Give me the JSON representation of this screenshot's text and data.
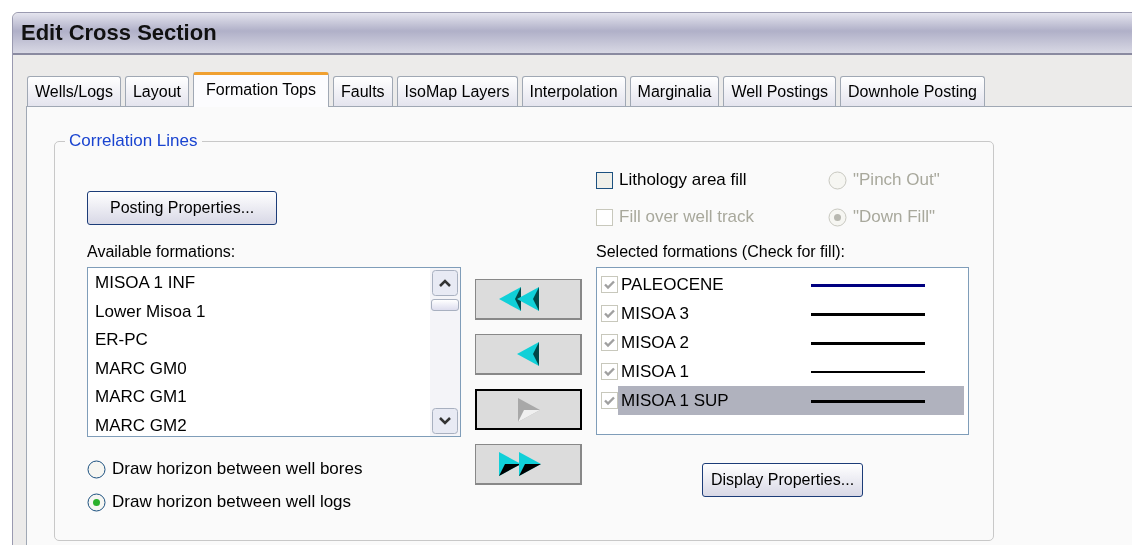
{
  "window": {
    "title": "Edit Cross Section"
  },
  "tabs": [
    {
      "label": "Wells/Logs",
      "selected": false
    },
    {
      "label": "Layout",
      "selected": false
    },
    {
      "label": "Formation Tops",
      "selected": true
    },
    {
      "label": "Faults",
      "selected": false
    },
    {
      "label": "IsoMap Layers",
      "selected": false
    },
    {
      "label": "Interpolation",
      "selected": false
    },
    {
      "label": "Marginalia",
      "selected": false
    },
    {
      "label": "Well Postings",
      "selected": false
    },
    {
      "label": "Downhole Posting",
      "selected": false
    }
  ],
  "group": {
    "title": "Correlation Lines"
  },
  "posting_button": "Posting Properties...",
  "available": {
    "label": "Available formations:",
    "items": [
      {
        "label": "MISOA 1 INF",
        "selected": false
      },
      {
        "label": "Lower Misoa 1",
        "selected": false
      },
      {
        "label": "ER-PC",
        "selected": false
      },
      {
        "label": "MARC GM0",
        "selected": false
      },
      {
        "label": "MARC GM1",
        "selected": false
      },
      {
        "label": "MARC GM2",
        "selected": false
      }
    ]
  },
  "horizon_options": [
    {
      "label": "Draw horizon between well bores",
      "selected": false
    },
    {
      "label": "Draw horizon between well logs",
      "selected": true
    }
  ],
  "move_buttons": [
    {
      "kind": "all-left",
      "disabled": false,
      "focused": false
    },
    {
      "kind": "left",
      "disabled": false,
      "focused": false
    },
    {
      "kind": "right",
      "disabled": true,
      "focused": true
    },
    {
      "kind": "all-right",
      "disabled": false,
      "focused": false
    }
  ],
  "fill_options": [
    {
      "kind": "checkbox",
      "label": "Lithology area fill",
      "checked": false,
      "disabled": false
    },
    {
      "kind": "radio",
      "label": "\"Pinch Out\"",
      "selected": false,
      "disabled": true
    },
    {
      "kind": "checkbox",
      "label": "Fill over well track",
      "checked": false,
      "disabled": true
    },
    {
      "kind": "radio",
      "label": "\"Down Fill\"",
      "selected": true,
      "disabled": true
    }
  ],
  "selected_formations": {
    "label": "Selected formations (Check for fill):",
    "items": [
      {
        "label": "PALEOCENE",
        "checked": true,
        "selected": false,
        "kind": "thick-line",
        "color": "#000080"
      },
      {
        "label": "MISOA 3",
        "checked": true,
        "selected": false,
        "kind": "thick-line",
        "color": "#000000"
      },
      {
        "label": "MISOA 2",
        "checked": true,
        "selected": false,
        "kind": "thick-line",
        "color": "#000000"
      },
      {
        "label": "MISOA 1",
        "checked": true,
        "selected": false,
        "kind": "thin-line",
        "color": "#000000"
      },
      {
        "label": "MISOA 1 SUP",
        "checked": true,
        "selected": true,
        "kind": "thick-line",
        "color": "#000000"
      }
    ]
  },
  "display_button": "Display Properties..."
}
